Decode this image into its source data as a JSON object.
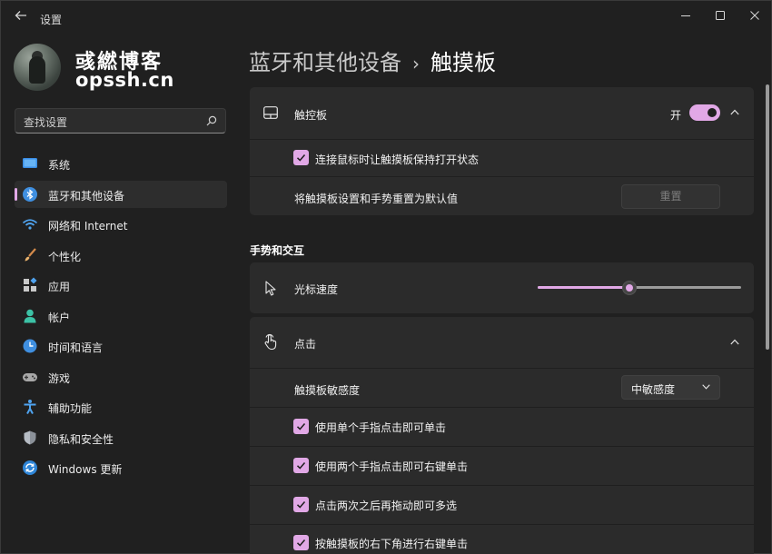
{
  "window": {
    "title": "设置",
    "back_icon": "back-arrow-icon",
    "controls": [
      "minimize-icon",
      "maximize-icon",
      "close-icon"
    ]
  },
  "profile": {
    "brand_cn": "彧繎博客",
    "brand_en": "opssh.cn"
  },
  "search": {
    "placeholder": "查找设置",
    "icon": "search-icon"
  },
  "nav": {
    "items": [
      {
        "label": "系统",
        "icon": "system-icon"
      },
      {
        "label": "蓝牙和其他设备",
        "icon": "bluetooth-icon",
        "active": true
      },
      {
        "label": "网络和 Internet",
        "icon": "wifi-icon"
      },
      {
        "label": "个性化",
        "icon": "brush-icon"
      },
      {
        "label": "应用",
        "icon": "apps-icon"
      },
      {
        "label": "帐户",
        "icon": "account-icon"
      },
      {
        "label": "时间和语言",
        "icon": "time-language-icon"
      },
      {
        "label": "游戏",
        "icon": "gamepad-icon"
      },
      {
        "label": "辅助功能",
        "icon": "accessibility-icon"
      },
      {
        "label": "隐私和安全性",
        "icon": "shield-icon"
      },
      {
        "label": "Windows 更新",
        "icon": "windows-update-icon"
      }
    ]
  },
  "breadcrumb": {
    "parent": "蓝牙和其他设备",
    "separator": "›",
    "current": "触摸板"
  },
  "touchpad_card": {
    "title": "触控板",
    "icon": "touchpad-icon",
    "toggle_label": "开",
    "toggle_on": true,
    "keep_on_label": "连接鼠标时让触摸板保持打开状态",
    "reset_label": "将触摸板设置和手势重置为默认值",
    "reset_button": "重置"
  },
  "gestures": {
    "section_title": "手势和交互",
    "cursor_speed_label": "光标速度",
    "cursor_icon": "cursor-icon",
    "cursor_speed_level": 0.45
  },
  "tap_card": {
    "title": "点击",
    "icon": "tap-hand-icon",
    "sensitivity_label": "触摸板敏感度",
    "sensitivity_value": "中敏感度",
    "options": [
      {
        "label": "使用单个手指点击即可单击",
        "checked": true
      },
      {
        "label": "使用两个手指点击即可右键单击",
        "checked": true
      },
      {
        "label": "点击两次之后再拖动即可多选",
        "checked": true
      },
      {
        "label": "按触摸板的右下角进行右键单击",
        "checked": true
      }
    ]
  },
  "colors": {
    "accent": "#e1a8e6",
    "background": "#202020",
    "card": "#2b2b2b"
  }
}
